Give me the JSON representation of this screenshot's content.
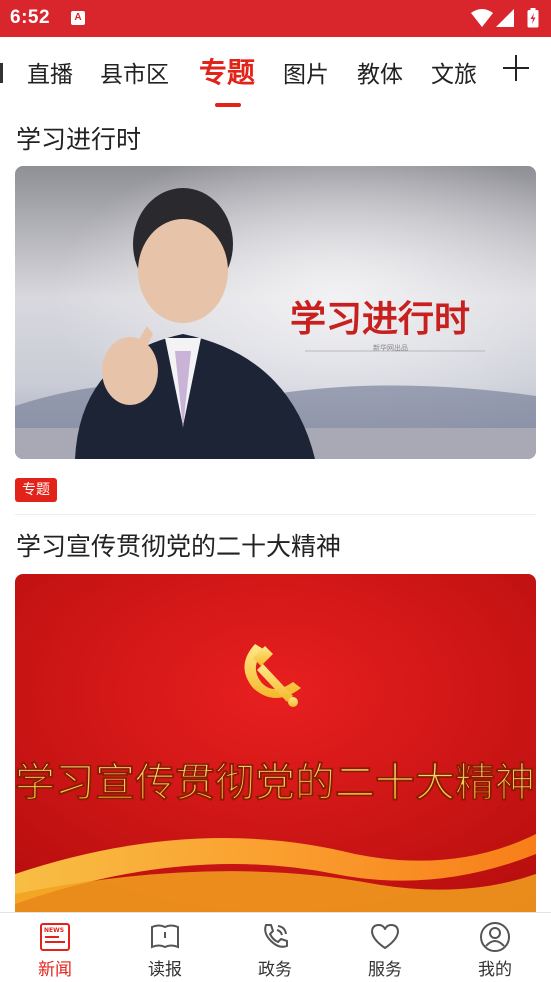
{
  "status_bar": {
    "time": "6:52",
    "app_icon": "A",
    "icons": [
      "wifi-icon",
      "signal-icon",
      "battery-icon"
    ]
  },
  "nav": {
    "tabs": [
      {
        "label": "直播"
      },
      {
        "label": "县市区"
      },
      {
        "label": "专题",
        "active": true
      },
      {
        "label": "图片"
      },
      {
        "label": "教体"
      },
      {
        "label": "文旅"
      }
    ],
    "more_icon": "plus-icon"
  },
  "articles": [
    {
      "title": "学习进行时",
      "image_text": "学习进行时",
      "image_subtext": "新华网出品",
      "tag": "专题"
    },
    {
      "title": "学习宣传贯彻党的二十大精神",
      "image_text": "学习宣传贯彻党的二十大精神"
    }
  ],
  "tabbar": {
    "items": [
      {
        "label": "新闻",
        "icon": "news-icon",
        "active": true
      },
      {
        "label": "读报",
        "icon": "newspaper-icon"
      },
      {
        "label": "政务",
        "icon": "phone-icon"
      },
      {
        "label": "服务",
        "icon": "heart-icon"
      },
      {
        "label": "我的",
        "icon": "user-icon"
      }
    ]
  },
  "colors": {
    "accent": "#e2231a",
    "status_bar": "#d9262c"
  }
}
